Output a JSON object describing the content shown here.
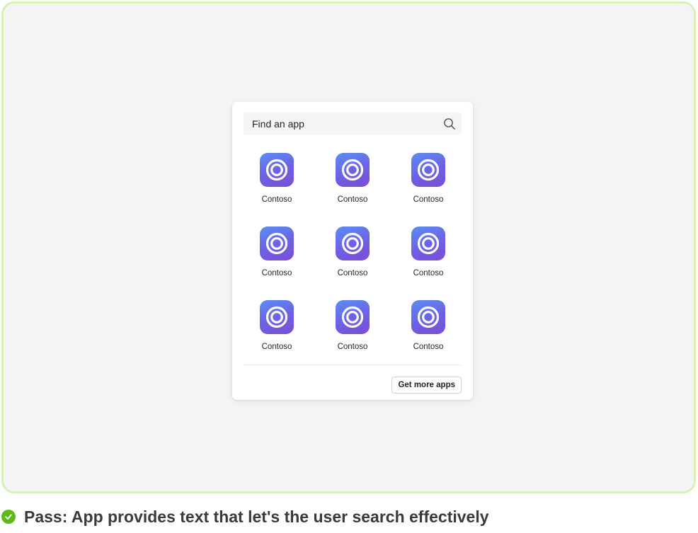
{
  "search": {
    "placeholder": "Find an app",
    "icon": "search-icon"
  },
  "apps": [
    {
      "label": "Contoso",
      "icon": "contoso-app-icon"
    },
    {
      "label": "Contoso",
      "icon": "contoso-app-icon"
    },
    {
      "label": "Contoso",
      "icon": "contoso-app-icon"
    },
    {
      "label": "Contoso",
      "icon": "contoso-app-icon"
    },
    {
      "label": "Contoso",
      "icon": "contoso-app-icon"
    },
    {
      "label": "Contoso",
      "icon": "contoso-app-icon"
    },
    {
      "label": "Contoso",
      "icon": "contoso-app-icon"
    },
    {
      "label": "Contoso",
      "icon": "contoso-app-icon"
    },
    {
      "label": "Contoso",
      "icon": "contoso-app-icon"
    }
  ],
  "footer": {
    "get_more_label": "Get more apps"
  },
  "caption": {
    "text": "Pass: App provides text that let's the user search effectively",
    "status_color": "#5fb91a"
  },
  "colors": {
    "frame_border": "#d5f2b8",
    "frame_background": "#f4f4f4",
    "app_icon_gradient": [
      "#5c8ef2",
      "#7d4bd3"
    ]
  }
}
